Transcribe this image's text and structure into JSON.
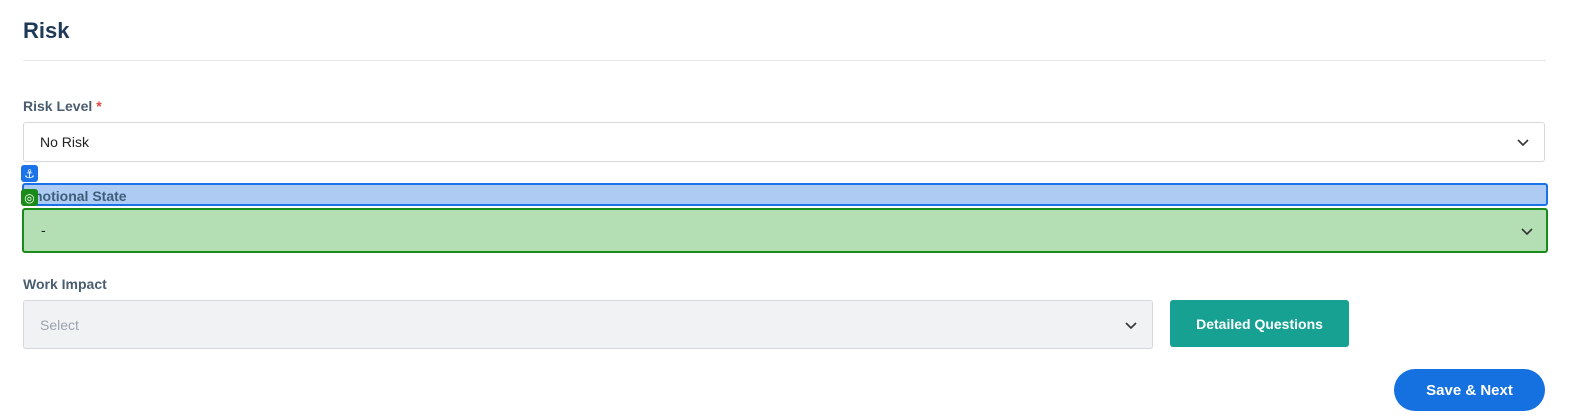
{
  "section": {
    "title": "Risk"
  },
  "risk_level": {
    "label": "Risk Level",
    "required_mark": "*",
    "value": "No Risk"
  },
  "emotional_state": {
    "label": "notional State",
    "value": "-"
  },
  "work_impact": {
    "label": "Work Impact",
    "placeholder": "Select",
    "detail_button": "Detailed Questions"
  },
  "footer": {
    "save_next": "Save & Next"
  },
  "colors": {
    "title": "#1f3a56",
    "teal": "#17a193",
    "primary": "#1570e0",
    "overlay_blue": "#1a73e8",
    "overlay_green": "#1a8a1a"
  },
  "icons": {
    "anchor": "anchor-icon",
    "target": "target-icon",
    "chevron": "chevron-down-icon"
  }
}
